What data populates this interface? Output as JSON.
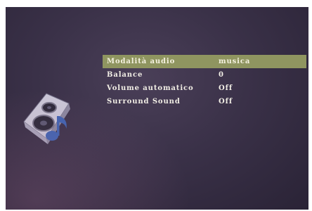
{
  "menu": {
    "items": [
      {
        "label": "Modalità audio",
        "value": "musica",
        "selected": true
      },
      {
        "label": "Balance",
        "value": "0",
        "selected": false
      },
      {
        "label": "Volume automatico",
        "value": "Off",
        "selected": false
      },
      {
        "label": "Surround Sound",
        "value": "Off",
        "selected": false
      }
    ]
  },
  "icon": {
    "name": "speaker-music-icon"
  },
  "colors": {
    "background": "#3a3148",
    "highlight": "#8f9560",
    "text": "#f2efe6"
  }
}
